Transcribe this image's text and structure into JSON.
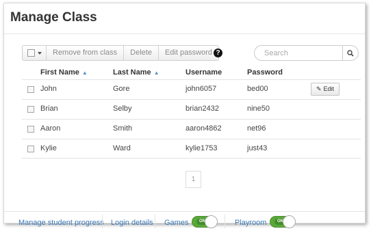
{
  "page": {
    "title": "Manage Class"
  },
  "toolbar": {
    "remove_label": "Remove from class",
    "delete_label": "Delete",
    "edit_password_label": "Edit password",
    "help_glyph": "?"
  },
  "search": {
    "placeholder": "Search",
    "value": ""
  },
  "table": {
    "columns": {
      "first_name": "First Name",
      "last_name": "Last Name",
      "username": "Username",
      "password": "Password"
    },
    "rows": [
      {
        "first_name": "John",
        "last_name": "Gore",
        "username": "john6057",
        "password": "bed00",
        "checked": false
      },
      {
        "first_name": "Brian",
        "last_name": "Selby",
        "username": "brian2432",
        "password": "nine50",
        "checked": false
      },
      {
        "first_name": "Aaron",
        "last_name": "Smith",
        "username": "aaron4862",
        "password": "net96",
        "checked": false
      },
      {
        "first_name": "Kylie",
        "last_name": "Ward",
        "username": "kylie1753",
        "password": "just43",
        "checked": false
      }
    ],
    "edit_label": "Edit"
  },
  "pagination": {
    "current_page": "1"
  },
  "footer": {
    "manage_progress": "Manage student progress",
    "login_details": "Login details",
    "games_label": "Games",
    "games_toggle": "ON",
    "playroom_label": "Playroom",
    "playroom_toggle": "ON"
  },
  "colors": {
    "link": "#3d7ab8",
    "toggle_on": "#5aa83a",
    "sort_icon": "#5b8fc7"
  },
  "icons": [
    "select-all-checkbox-icon",
    "chevron-down-icon",
    "help-icon",
    "search-icon",
    "sort-icon",
    "pencil-icon"
  ]
}
